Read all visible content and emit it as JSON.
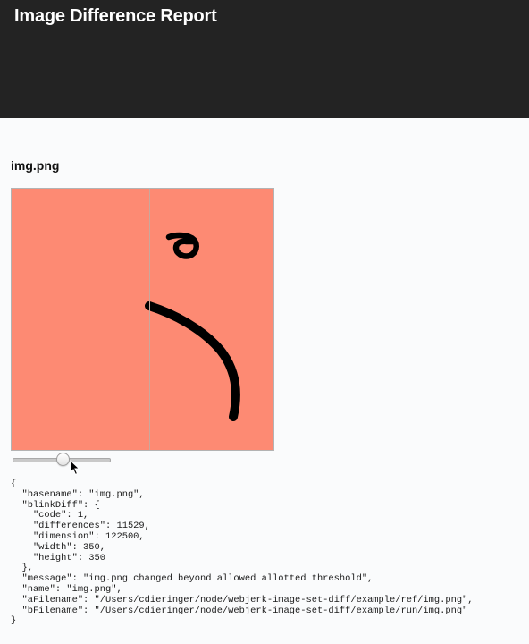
{
  "header": {
    "title": "Image Difference Report"
  },
  "image": {
    "name": "img.png",
    "background_color": "#fd8a73",
    "stroke_color": "#000000",
    "slider_position": 0.5
  },
  "json_dump": {
    "lines": [
      "{",
      "  \"basename\": \"img.png\",",
      "  \"blinkDiff\": {",
      "    \"code\": 1,",
      "    \"differences\": 11529,",
      "    \"dimension\": 122500,",
      "    \"width\": 350,",
      "    \"height\": 350",
      "  },",
      "  \"message\": \"img.png changed beyond allowed allotted threshold\",",
      "  \"name\": \"img.png\",",
      "  \"aFilename\": \"/Users/cdieringer/node/webjerk-image-set-diff/example/ref/img.png\",",
      "  \"bFilename\": \"/Users/cdieringer/node/webjerk-image-set-diff/example/run/img.png\"",
      "}"
    ]
  }
}
